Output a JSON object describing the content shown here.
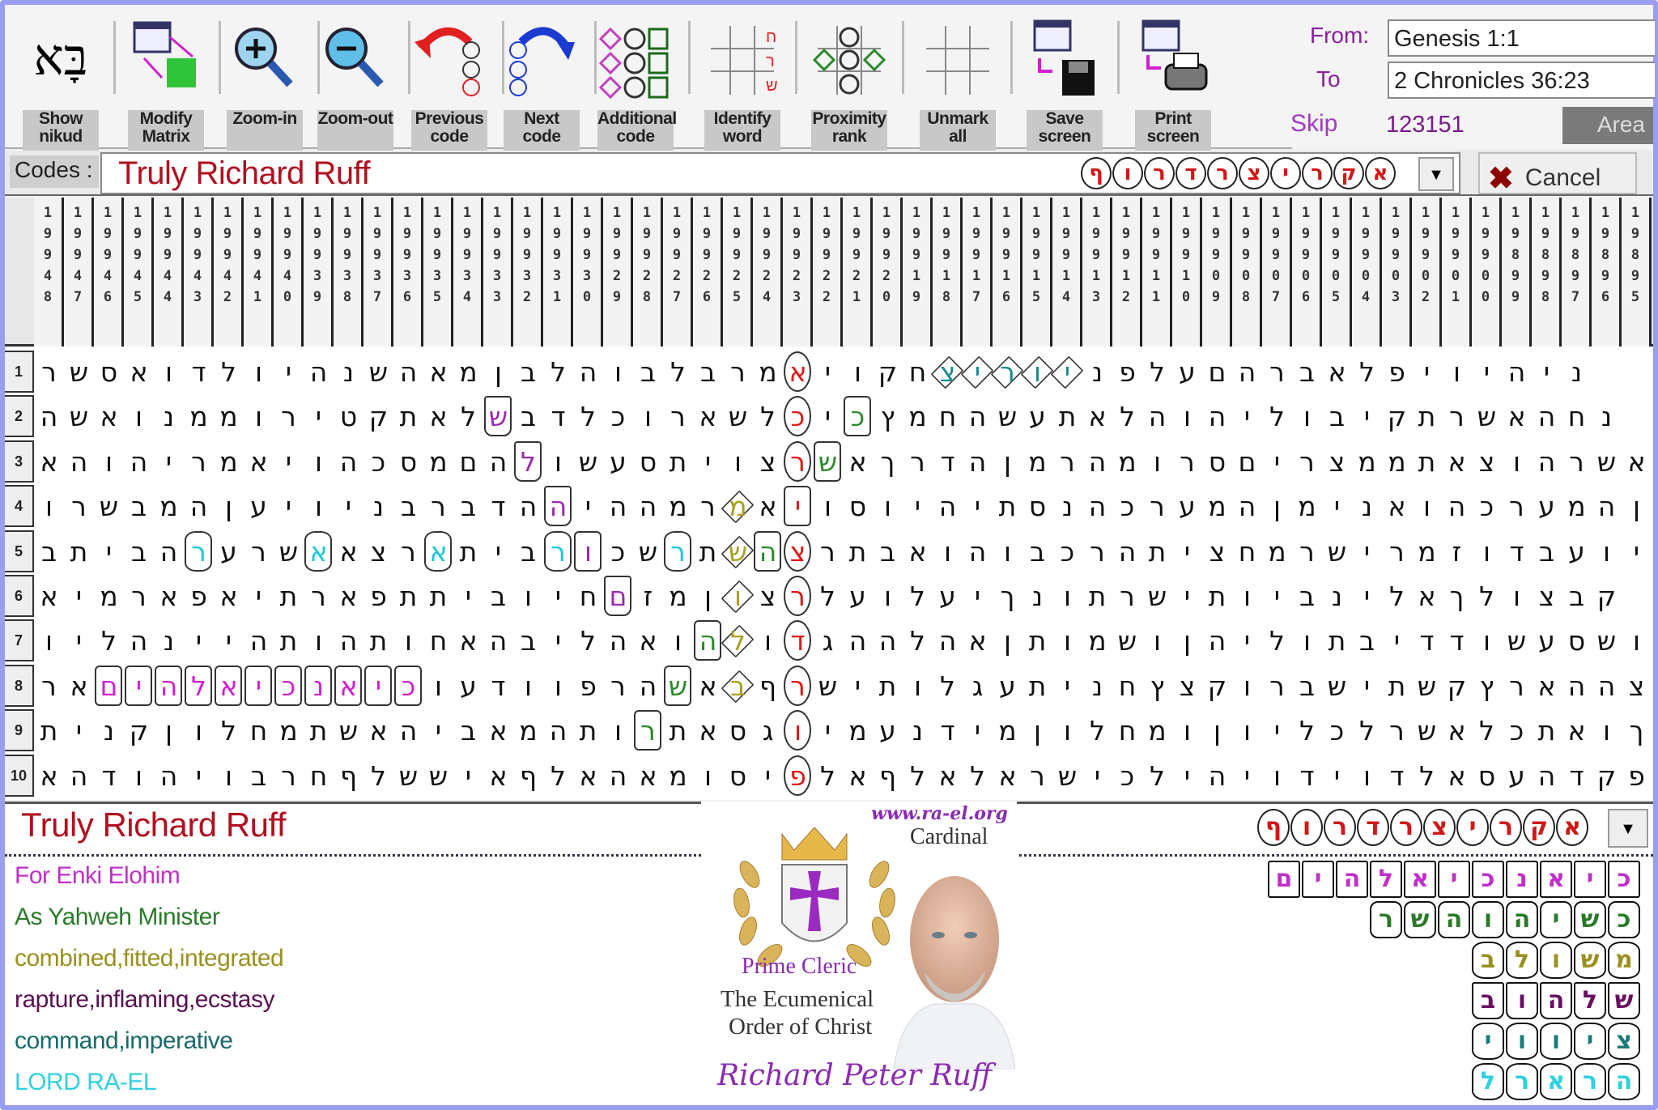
{
  "toolbar": {
    "buttons": [
      {
        "id": "show-nikud",
        "label": "Show\nnikud",
        "icon": "nikud-icon"
      },
      {
        "id": "modify-matrix",
        "label": "Modify\nMatrix",
        "icon": "modify-matrix-icon"
      },
      {
        "id": "zoom-in",
        "label": "Zoom-in",
        "icon": "zoom-in-icon"
      },
      {
        "id": "zoom-out",
        "label": "Zoom-out",
        "icon": "zoom-out-icon"
      },
      {
        "id": "previous-code",
        "label": "Previous\ncode",
        "icon": "previous-code-icon"
      },
      {
        "id": "next-code",
        "label": "Next\ncode",
        "icon": "next-code-icon"
      },
      {
        "id": "additional-code",
        "label": "Additional\ncode",
        "icon": "additional-code-icon"
      },
      {
        "id": "identify-word",
        "label": "Identify\nword",
        "icon": "identify-word-icon"
      },
      {
        "id": "proximity-rank",
        "label": "Proximity\nrank",
        "icon": "proximity-rank-icon"
      },
      {
        "id": "unmark-all",
        "label": "Unmark\nall",
        "icon": "unmark-all-icon"
      },
      {
        "id": "save-screen",
        "label": "Save\nscreen",
        "icon": "save-screen-icon"
      },
      {
        "id": "print-screen",
        "label": "Print\nscreen",
        "icon": "print-screen-icon"
      }
    ]
  },
  "range": {
    "from_label": "From:",
    "from_value": "Genesis 1:1",
    "to_label": "To",
    "to_value": "2 Chronicles 36:23",
    "skip_label": "Skip",
    "skip_value": "123151",
    "area_label": "Area"
  },
  "codes": {
    "label": "Codes :",
    "value": "Truly Richard Ruff",
    "letters": [
      "א",
      "ק",
      "ר",
      "י",
      "צ",
      "ר",
      "ד",
      "ר",
      "ו",
      "ף"
    ],
    "cancel_label": "Cancel"
  },
  "matrix": {
    "column_headers": [
      19948,
      19947,
      19946,
      19945,
      19944,
      19943,
      19942,
      19941,
      19940,
      19939,
      19938,
      19937,
      19936,
      19935,
      19934,
      19933,
      19932,
      19931,
      19930,
      19929,
      19928,
      19927,
      19926,
      19925,
      19924,
      19923,
      19922,
      19921,
      19920,
      19919,
      19918,
      19917,
      19916,
      19915,
      19914,
      19913,
      19912,
      19911,
      19910,
      19909,
      19908,
      19907,
      19906,
      19905,
      19904,
      19903,
      19902,
      19901,
      19900,
      19899,
      19898,
      19897,
      19896,
      19895
    ],
    "row_numbers": [
      "1",
      "2",
      "3",
      "4",
      "5",
      "6",
      "7",
      "8",
      "9",
      "10"
    ],
    "rows": [
      "רשסאודלויהנשהאמןבלהובלברמאיוקחצירוינפלעםהרבאלפיויהינ",
      "השאונממוריטקתאלשבדלכוראשלכיכץמחהשעתאלהוהילוביקתרשאהחנ",
      "אהוהירמאיוהכסמםהלושעסתיוצרשאךרדהןמרהמורסםירצממתאצוהרשא",
      "ורשבמהןעיוינברבדההיההמרמאיוסויהיתסנהכרעמהןמינאוהכרעמהן",
      "בתיבהרערשאאצראתיברוכשרתשהצרתבאוהובכרהתיצחמרשירמזודבעוי",
      "אימראפאיתראפתתיבויחםזמןוצרלעולעיךנותרשיתויבנילאךלוצבק",
      "וילהנייהתוהתוחאהביל האוהלודגההלהאןתומשוןהילותבידדושעסשו",
      "ראםיהלאיכנאיכועדווּפרהשאבףרשיתולגעתינחץצקורבשיתשקץראההצ",
      "תינקןולחמתשאהיבאמהתורתאסגוימענדימןולחמוןוילכלרשאלכתאוך",
      "אהדוהיוברחףלששיאףלאהאמוסיפלאףלאלארשיכליהיודיודלאסעהדקפ"
    ],
    "code_column": 25,
    "marks": [
      {
        "r": 0,
        "c": 25,
        "shape": "circle",
        "color": "#e01818"
      },
      {
        "r": 1,
        "c": 25,
        "shape": "circle",
        "color": "#e01818"
      },
      {
        "r": 2,
        "c": 25,
        "shape": "circle",
        "color": "#e01818"
      },
      {
        "r": 3,
        "c": 25,
        "shape": "box",
        "color": "#e01818"
      },
      {
        "r": 4,
        "c": 25,
        "shape": "circle",
        "color": "#e01818"
      },
      {
        "r": 5,
        "c": 25,
        "shape": "circle",
        "color": "#e01818"
      },
      {
        "r": 6,
        "c": 25,
        "shape": "circle",
        "color": "#e01818"
      },
      {
        "r": 7,
        "c": 25,
        "shape": "circle",
        "color": "#e01818"
      },
      {
        "r": 8,
        "c": 25,
        "shape": "circle",
        "color": "#e01818"
      },
      {
        "r": 9,
        "c": 25,
        "shape": "circle",
        "color": "#e01818"
      },
      {
        "r": 1,
        "c": 15,
        "shape": "cup",
        "color": "#9b2bb0"
      },
      {
        "r": 2,
        "c": 16,
        "shape": "cup",
        "color": "#9b2bb0"
      },
      {
        "r": 3,
        "c": 17,
        "shape": "cup",
        "color": "#9b2bb0"
      },
      {
        "r": 4,
        "c": 18,
        "shape": "cup",
        "color": "#9b2bb0"
      },
      {
        "r": 5,
        "c": 19,
        "shape": "cup",
        "color": "#9b2bb0"
      },
      {
        "r": 1,
        "c": 27,
        "shape": "box",
        "color": "#2a8a2a"
      },
      {
        "r": 2,
        "c": 26,
        "shape": "box",
        "color": "#2a8a2a"
      },
      {
        "r": 4,
        "c": 24,
        "shape": "box",
        "color": "#2a8a2a"
      },
      {
        "r": 6,
        "c": 22,
        "shape": "box",
        "color": "#2a8a2a"
      },
      {
        "r": 7,
        "c": 21,
        "shape": "box",
        "color": "#2a8a2a"
      },
      {
        "r": 8,
        "c": 20,
        "shape": "box",
        "color": "#2a8a2a"
      },
      {
        "r": 3,
        "c": 23,
        "shape": "diamond",
        "color": "#a8a020"
      },
      {
        "r": 4,
        "c": 23,
        "shape": "diamond",
        "color": "#a8a020"
      },
      {
        "r": 5,
        "c": 23,
        "shape": "diamond",
        "color": "#a8a020"
      },
      {
        "r": 6,
        "c": 23,
        "shape": "diamond",
        "color": "#a8a020"
      },
      {
        "r": 7,
        "c": 23,
        "shape": "diamond",
        "color": "#a8a020"
      },
      {
        "r": 0,
        "c": 30,
        "shape": "diamond",
        "color": "#1a8a8a"
      },
      {
        "r": 0,
        "c": 31,
        "shape": "diamond",
        "color": "#1a8a8a"
      },
      {
        "r": 0,
        "c": 32,
        "shape": "diamond",
        "color": "#1a8a8a"
      },
      {
        "r": 0,
        "c": 33,
        "shape": "diamond",
        "color": "#1a8a8a"
      },
      {
        "r": 0,
        "c": 34,
        "shape": "diamond",
        "color": "#1a8a8a"
      },
      {
        "r": 4,
        "c": 5,
        "shape": "hex",
        "color": "#20c8d8"
      },
      {
        "r": 4,
        "c": 9,
        "shape": "hex",
        "color": "#20c8d8"
      },
      {
        "r": 4,
        "c": 13,
        "shape": "hex",
        "color": "#20c8d8"
      },
      {
        "r": 4,
        "c": 17,
        "shape": "hex",
        "color": "#20c8d8"
      },
      {
        "r": 4,
        "c": 21,
        "shape": "hex",
        "color": "#20c8d8"
      },
      {
        "r": 4,
        "c": 18,
        "shape": "box",
        "color": "#9b2bb0"
      },
      {
        "r": 5,
        "c": 19,
        "shape": "cup",
        "color": "#9b2bb0"
      },
      {
        "r": 7,
        "c": 2,
        "shape": "box",
        "color": "#d020d0"
      },
      {
        "r": 7,
        "c": 3,
        "shape": "box",
        "color": "#d020d0"
      },
      {
        "r": 7,
        "c": 4,
        "shape": "box",
        "color": "#d020d0"
      },
      {
        "r": 7,
        "c": 5,
        "shape": "box",
        "color": "#d020d0"
      },
      {
        "r": 7,
        "c": 6,
        "shape": "box",
        "color": "#d020d0"
      },
      {
        "r": 7,
        "c": 7,
        "shape": "box",
        "color": "#d020d0"
      },
      {
        "r": 7,
        "c": 8,
        "shape": "box",
        "color": "#d020d0"
      },
      {
        "r": 7,
        "c": 9,
        "shape": "box",
        "color": "#d020d0"
      },
      {
        "r": 7,
        "c": 10,
        "shape": "box",
        "color": "#d020d0"
      },
      {
        "r": 7,
        "c": 11,
        "shape": "box",
        "color": "#d020d0"
      },
      {
        "r": 7,
        "c": 12,
        "shape": "box",
        "color": "#d020d0"
      }
    ]
  },
  "bottom": {
    "code_title": "Truly Richard Ruff",
    "meanings": [
      {
        "text": "For Enki Elohim",
        "color": "#c030c8"
      },
      {
        "text": "As Yahweh Minister",
        "color": "#2a7a2a"
      },
      {
        "text": "combined,fitted,integrated",
        "color": "#9a9020"
      },
      {
        "text": "rapture,inflaming,ecstasy",
        "color": "#5a1050"
      },
      {
        "text": "command,imperative",
        "color": "#1a6a6a"
      },
      {
        "text": "LORD RA-EL",
        "color": "#30d0e0"
      }
    ],
    "code_letters": [
      "א",
      "ק",
      "ר",
      "י",
      "צ",
      "ר",
      "ד",
      "ר",
      "ו",
      "ף"
    ],
    "legend": [
      {
        "letters": [
          "כ",
          "י",
          "א",
          "נ",
          "כ",
          "י",
          "א",
          "ל",
          "ה",
          "י",
          "ם"
        ],
        "shape": "box",
        "color": "#c030c8"
      },
      {
        "letters": [
          "כ",
          "ש",
          "י",
          "ה",
          "ו",
          "ה",
          "ש",
          "ר"
        ],
        "shape": "rbox",
        "color": "#2a7a2a"
      },
      {
        "letters": [
          "מ",
          "ש",
          "ו",
          "ל",
          "ב"
        ],
        "shape": "hex",
        "color": "#9a9020"
      },
      {
        "letters": [
          "ש",
          "ל",
          "ה",
          "ו",
          "ב"
        ],
        "shape": "cup",
        "color": "#6a1060"
      },
      {
        "letters": [
          "צ",
          "י",
          "ו",
          "ו",
          "י"
        ],
        "shape": "hex",
        "color": "#1a7a7a"
      },
      {
        "letters": [
          "ה",
          "ר",
          "א",
          "ר",
          "ל"
        ],
        "shape": "hex",
        "color": "#30d0e0"
      }
    ]
  },
  "badge": {
    "url": "www.ra-el.org",
    "title": "Cardinal",
    "rank": "Prime Cleric",
    "order_line1": "The Ecumenical",
    "order_line2": "Order of Christ",
    "signature": "Richard Peter Ruff"
  }
}
